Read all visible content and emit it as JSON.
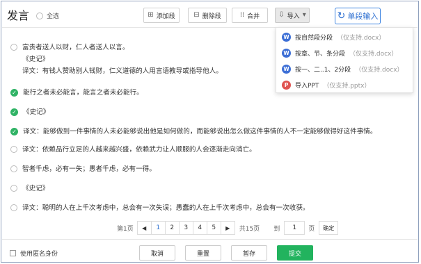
{
  "header": {
    "title": "发言",
    "select_all": "全选",
    "add_paragraph": "添加段",
    "delete_paragraph": "删除段",
    "merge": "合并",
    "import": "导入",
    "single_input": "单段输入"
  },
  "import_menu": [
    {
      "icon": "W",
      "label": "按自然段分段",
      "hint": "（仅支持.docx）"
    },
    {
      "icon": "W",
      "label": "按章、节、条分段",
      "hint": "（仅支持.docx）"
    },
    {
      "icon": "W",
      "label": "按一、二..1、2分段",
      "hint": "（仅支持.docx）"
    },
    {
      "icon": "P",
      "label": "导入PPT",
      "hint": "（仅支持.pptx）"
    }
  ],
  "items": [
    {
      "checked": false,
      "lines": [
        "富贵者送人以财，仁人者送人以言。",
        "《史记》",
        "译文：有钱人赞助别人钱财，仁义道德的人用言语教导或指导他人。"
      ]
    },
    {
      "checked": true,
      "lines": [
        "能行之者未必能言，能言之者未必能行。"
      ]
    },
    {
      "checked": true,
      "lines": [
        "《史记》"
      ]
    },
    {
      "checked": true,
      "lines": [
        "译文：能够做到一件事情的人未必能够说出他是如何做的，而能够说出怎么做这件事情的人不一定能够做得好这件事情。"
      ]
    },
    {
      "checked": false,
      "lines": [
        "译文：依赖品行立足的人越来越兴盛，依赖武力让人顺服的人会逐渐走向消亡。"
      ]
    },
    {
      "checked": false,
      "lines": [
        "智者千虑，必有一失；愚者千虑，必有一得。"
      ]
    },
    {
      "checked": false,
      "lines": [
        "《史记》"
      ]
    },
    {
      "checked": false,
      "lines": [
        "译文：聪明的人在上千次考虑中，总会有一次失误；愚蠢的人在上千次考虑中，总会有一次收获。"
      ]
    }
  ],
  "pagination": {
    "first_label": "第1页",
    "prev": "◀",
    "pages": [
      "1",
      "2",
      "3",
      "4",
      "5"
    ],
    "active_page": "1",
    "next": "▶",
    "total_label": "共15页",
    "goto_label": "到",
    "goto_value": "1",
    "page_suffix": "页",
    "confirm": "确定"
  },
  "footer": {
    "anonymous_label": "使用匿名身份",
    "cancel": "取消",
    "reset": "重置",
    "save_draft": "暂存",
    "submit": "提交"
  },
  "colors": {
    "accent": "#2d6fd1",
    "check": "#2fb365",
    "submit": "#22b35e",
    "word_icon": "#3d6fd6",
    "ppt_icon": "#e0524f"
  }
}
